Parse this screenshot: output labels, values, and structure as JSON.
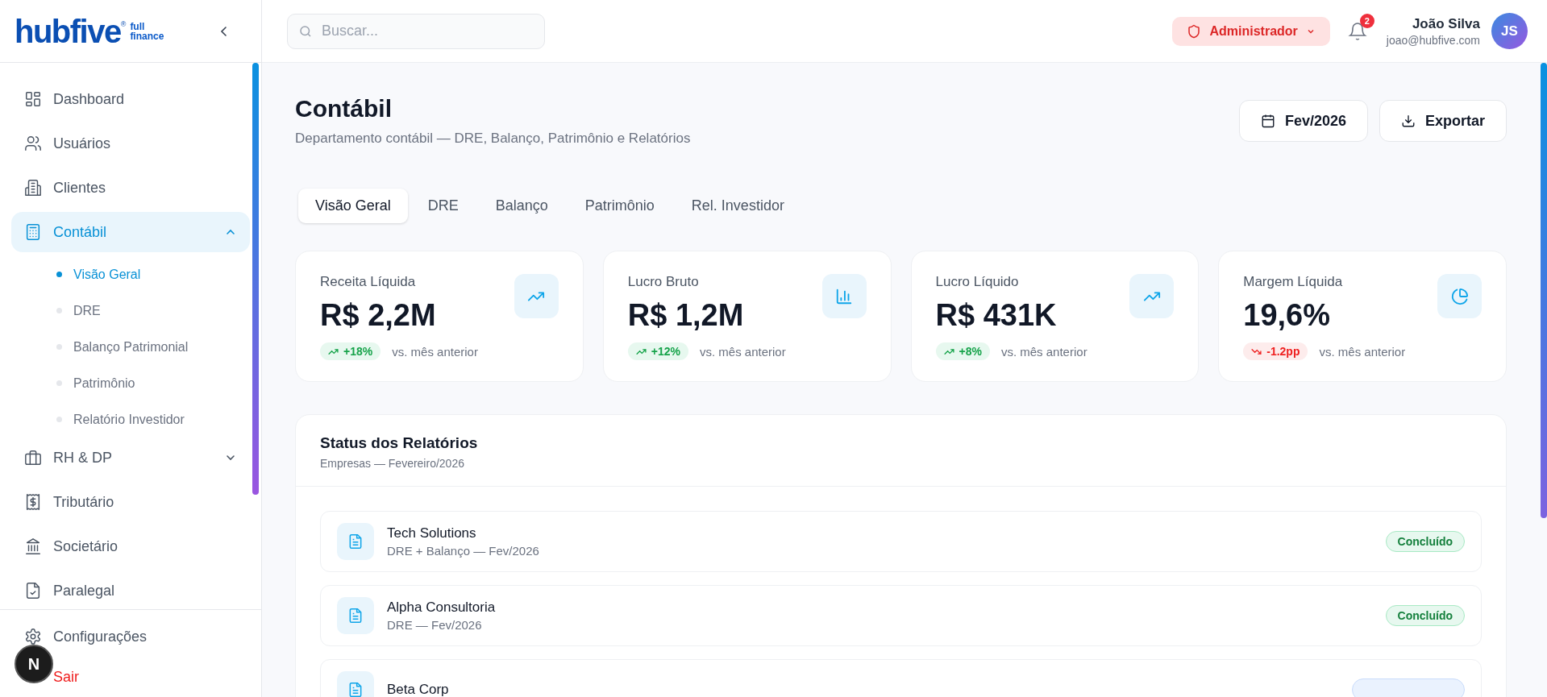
{
  "brand": {
    "name": "hubfive",
    "mark": "®",
    "tagline": [
      "full",
      "finance"
    ]
  },
  "sidebar": {
    "items": [
      {
        "label": "Dashboard",
        "selected": false
      },
      {
        "label": "Usuários",
        "selected": false
      },
      {
        "label": "Clientes",
        "selected": false
      },
      {
        "label": "Contábil",
        "selected": true,
        "expanded": true,
        "children": [
          {
            "label": "Visão Geral",
            "selected": true
          },
          {
            "label": "DRE",
            "selected": false
          },
          {
            "label": "Balanço Patrimonial",
            "selected": false
          },
          {
            "label": "Patrimônio",
            "selected": false
          },
          {
            "label": "Relatório Investidor",
            "selected": false
          }
        ]
      },
      {
        "label": "RH & DP",
        "selected": false,
        "expanded": false
      },
      {
        "label": "Tributário",
        "selected": false
      },
      {
        "label": "Societário",
        "selected": false
      },
      {
        "label": "Paralegal",
        "selected": false
      }
    ],
    "footer": [
      {
        "label": "Configurações",
        "kind": "settings"
      },
      {
        "label": "Sair",
        "kind": "logout"
      }
    ]
  },
  "dev_badge": "N",
  "header": {
    "search": {
      "placeholder": "Buscar..."
    },
    "role": "Administrador",
    "notifications": "2",
    "user": {
      "name": "João Silva",
      "email": "joao@hubfive.com",
      "initials": "JS"
    }
  },
  "page": {
    "title": "Contábil",
    "subtitle": "Departamento contábil — DRE, Balanço, Patrimônio e Relatórios",
    "period": "Fev/2026",
    "export": "Exportar"
  },
  "tabs": [
    {
      "label": "Visão Geral",
      "selected": true
    },
    {
      "label": "DRE",
      "selected": false
    },
    {
      "label": "Balanço",
      "selected": false
    },
    {
      "label": "Patrimônio",
      "selected": false
    },
    {
      "label": "Rel. Investidor",
      "selected": false
    }
  ],
  "kpis": [
    {
      "label": "Receita Líquida",
      "value": "R$ 2,2M",
      "delta": "+18%",
      "kind": "up",
      "note": "vs. mês anterior"
    },
    {
      "label": "Lucro Bruto",
      "value": "R$ 1,2M",
      "delta": "+12%",
      "kind": "up",
      "note": "vs. mês anterior"
    },
    {
      "label": "Lucro Líquido",
      "value": "R$ 431K",
      "delta": "+8%",
      "kind": "up",
      "note": "vs. mês anterior"
    },
    {
      "label": "Margem Líquida",
      "value": "19,6%",
      "delta": "-1.2pp",
      "kind": "down",
      "note": "vs. mês anterior"
    }
  ],
  "reports": {
    "title": "Status dos Relatórios",
    "subtitle": "Empresas — Fevereiro/2026",
    "rows": [
      {
        "name": "Tech Solutions",
        "detail": "DRE + Balanço — Fev/2026",
        "status": "Concluído",
        "kind": "done"
      },
      {
        "name": "Alpha Consultoria",
        "detail": "DRE — Fev/2026",
        "status": "Concluído",
        "kind": "done"
      },
      {
        "name": "Beta Corp",
        "kind": "progress"
      }
    ]
  }
}
